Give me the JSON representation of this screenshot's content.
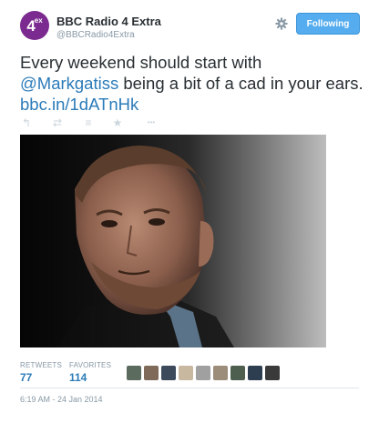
{
  "account": {
    "name": "BBC Radio 4 Extra",
    "handle": "@BBCRadio4Extra",
    "avatar_text": "4",
    "avatar_sup": "ex",
    "avatar_color": "#7b2a8f"
  },
  "follow_button": {
    "label": "Following",
    "color": "#55acee"
  },
  "settings_icon": "gear-icon",
  "tweet": {
    "text_before": "Every weekend should start with",
    "mention": "@Markgatiss",
    "text_middle": " being a bit of a cad in your ears. ",
    "link": "bbc.in/1dATnHk",
    "link_color": "#2b7bb9"
  },
  "actions": [
    {
      "name": "reply-icon",
      "glyph": "↰"
    },
    {
      "name": "retweet-icon",
      "glyph": "⇄"
    },
    {
      "name": "stack-icon",
      "glyph": "≡"
    },
    {
      "name": "favorite-icon",
      "glyph": "★"
    },
    {
      "name": "more-icon",
      "glyph": "•••"
    }
  ],
  "stats": {
    "retweets_label": "RETWEETS",
    "retweets_value": "77",
    "favorites_label": "FAVORITES",
    "favorites_value": "114"
  },
  "favoriters_avatar_colors": [
    "#5b6b5e",
    "#7f6a5a",
    "#3d4a5c",
    "#c8b8a0",
    "#a0a0a0",
    "#9c8c7a",
    "#4f5f4f",
    "#2c3e50",
    "#3a3a3a"
  ],
  "timestamp": "6:19 AM - 24 Jan 2014"
}
